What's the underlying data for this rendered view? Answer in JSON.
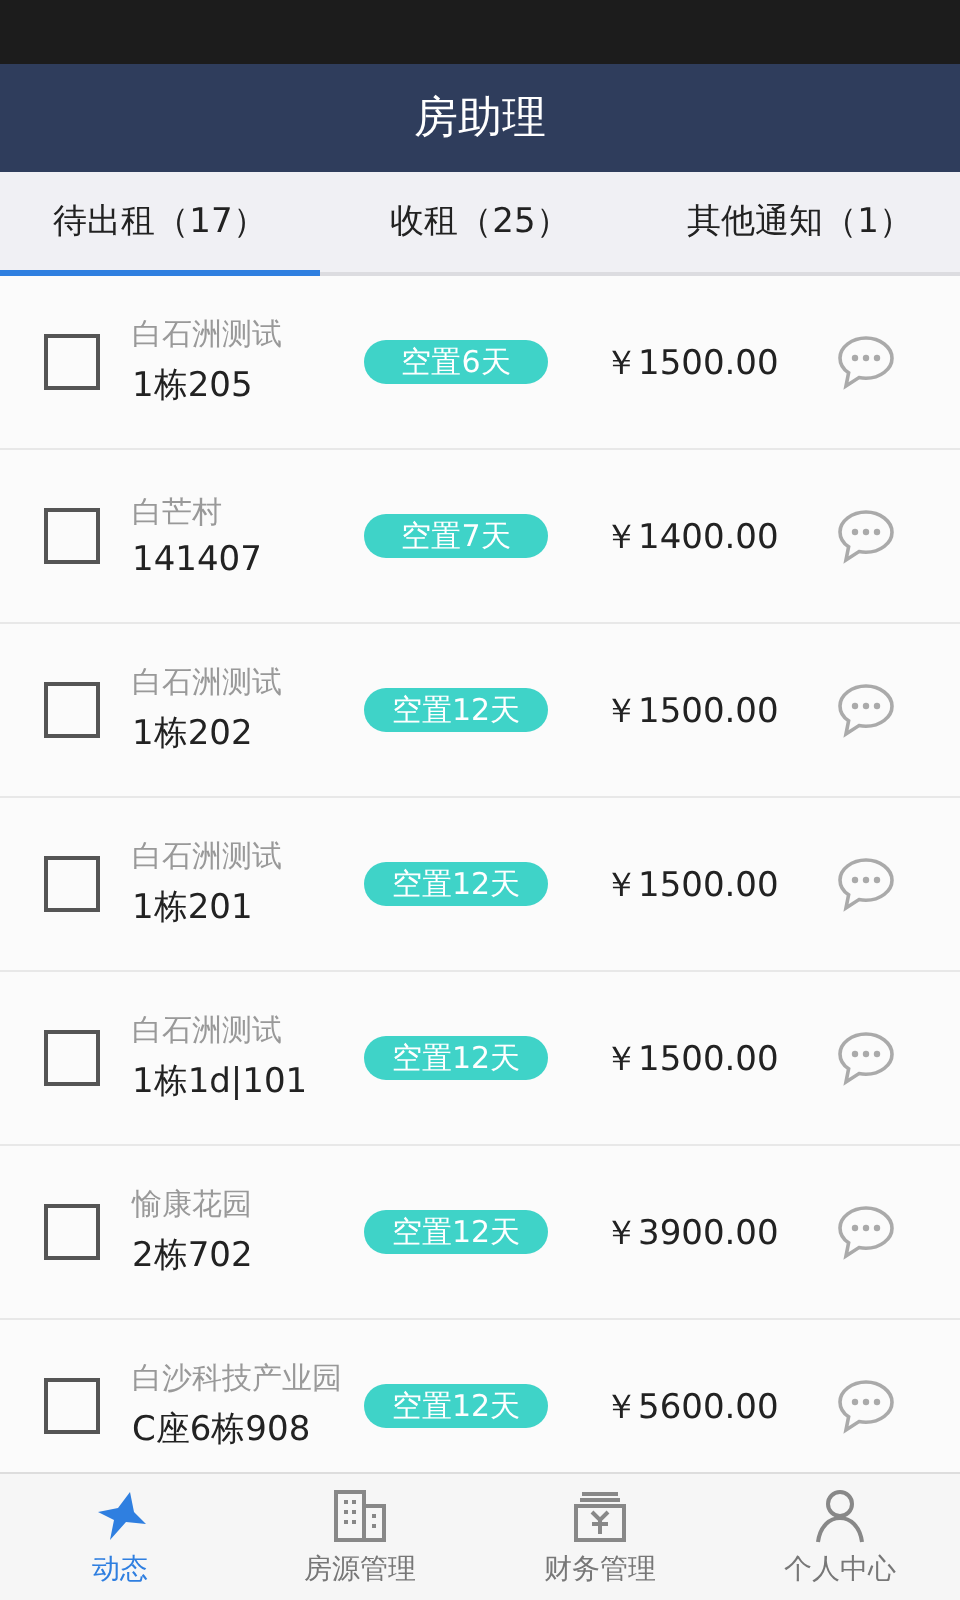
{
  "header": {
    "title": "房助理"
  },
  "tabs": [
    {
      "label": "待出租（17）",
      "selected": true
    },
    {
      "label": "收租（25）",
      "selected": false
    },
    {
      "label": "其他通知（1）",
      "selected": false
    }
  ],
  "rows": [
    {
      "estate": "白石洲测试",
      "unit": "1栋205",
      "vacancy": "空置6天",
      "price": "￥1500.00",
      "checked": false
    },
    {
      "estate": "白芒村",
      "unit": "141407",
      "vacancy": "空置7天",
      "price": "￥1400.00",
      "checked": false
    },
    {
      "estate": "白石洲测试",
      "unit": "1栋202",
      "vacancy": "空置12天",
      "price": "￥1500.00",
      "checked": false
    },
    {
      "estate": "白石洲测试",
      "unit": "1栋201",
      "vacancy": "空置12天",
      "price": "￥1500.00",
      "checked": false
    },
    {
      "estate": "白石洲测试",
      "unit": "1栋1d|101",
      "vacancy": "空置12天",
      "price": "￥1500.00",
      "checked": false
    },
    {
      "estate": "愉康花园",
      "unit": "2栋702",
      "vacancy": "空置12天",
      "price": "￥3900.00",
      "checked": false
    },
    {
      "estate": "白沙科技产业园",
      "unit": "C座6栋908",
      "vacancy": "空置12天",
      "price": "￥5600.00",
      "checked": false
    }
  ],
  "bottom_nav": [
    {
      "label": "动态",
      "kind": "feed",
      "selected": true
    },
    {
      "label": "房源管理",
      "kind": "building",
      "selected": false
    },
    {
      "label": "财务管理",
      "kind": "money",
      "selected": false
    },
    {
      "label": "个人中心",
      "kind": "person",
      "selected": false
    }
  ]
}
